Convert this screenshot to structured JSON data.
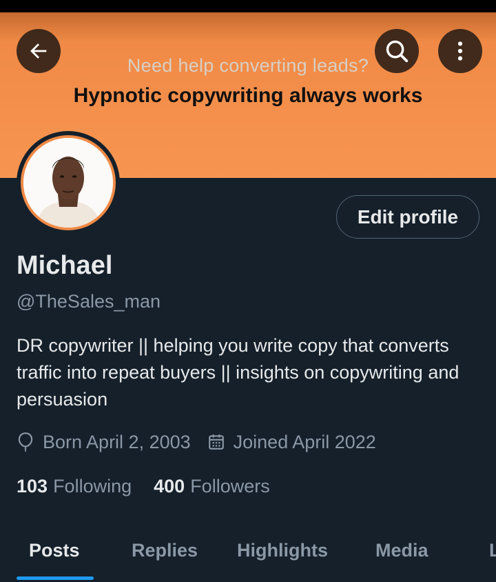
{
  "banner": {
    "subtitle": "Need help converting leads?",
    "title": "Hypnotic copywriting always works"
  },
  "header": {
    "back_icon": "arrow-left-icon",
    "search_icon": "search-icon",
    "more_icon": "more-vertical-icon"
  },
  "profile": {
    "edit_label": "Edit profile",
    "name": "Michael",
    "handle": "@TheSales_man",
    "bio": "DR copywriter || helping you write copy that converts traffic into repeat buyers || insights on copywriting and persuasion",
    "born": "Born April 2, 2003",
    "joined": "Joined April 2022",
    "following_count": "103",
    "following_label": "Following",
    "followers_count": "400",
    "followers_label": "Followers"
  },
  "tabs": [
    {
      "label": "Posts",
      "active": true
    },
    {
      "label": "Replies",
      "active": false
    },
    {
      "label": "Highlights",
      "active": false
    },
    {
      "label": "Media",
      "active": false
    },
    {
      "label": "L",
      "active": false
    }
  ],
  "colors": {
    "banner": "#f79550",
    "background": "#15202b",
    "accent": "#1d9bf0",
    "muted_text": "#8b98a5"
  }
}
